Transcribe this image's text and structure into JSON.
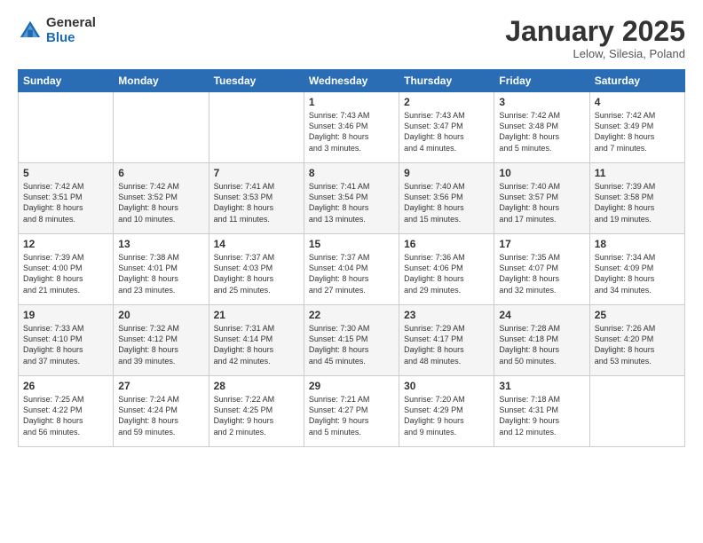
{
  "logo": {
    "general": "General",
    "blue": "Blue"
  },
  "header": {
    "title": "January 2025",
    "subtitle": "Lelow, Silesia, Poland"
  },
  "weekdays": [
    "Sunday",
    "Monday",
    "Tuesday",
    "Wednesday",
    "Thursday",
    "Friday",
    "Saturday"
  ],
  "weeks": [
    [
      {
        "day": "",
        "info": ""
      },
      {
        "day": "",
        "info": ""
      },
      {
        "day": "",
        "info": ""
      },
      {
        "day": "1",
        "info": "Sunrise: 7:43 AM\nSunset: 3:46 PM\nDaylight: 8 hours\nand 3 minutes."
      },
      {
        "day": "2",
        "info": "Sunrise: 7:43 AM\nSunset: 3:47 PM\nDaylight: 8 hours\nand 4 minutes."
      },
      {
        "day": "3",
        "info": "Sunrise: 7:42 AM\nSunset: 3:48 PM\nDaylight: 8 hours\nand 5 minutes."
      },
      {
        "day": "4",
        "info": "Sunrise: 7:42 AM\nSunset: 3:49 PM\nDaylight: 8 hours\nand 7 minutes."
      }
    ],
    [
      {
        "day": "5",
        "info": "Sunrise: 7:42 AM\nSunset: 3:51 PM\nDaylight: 8 hours\nand 8 minutes."
      },
      {
        "day": "6",
        "info": "Sunrise: 7:42 AM\nSunset: 3:52 PM\nDaylight: 8 hours\nand 10 minutes."
      },
      {
        "day": "7",
        "info": "Sunrise: 7:41 AM\nSunset: 3:53 PM\nDaylight: 8 hours\nand 11 minutes."
      },
      {
        "day": "8",
        "info": "Sunrise: 7:41 AM\nSunset: 3:54 PM\nDaylight: 8 hours\nand 13 minutes."
      },
      {
        "day": "9",
        "info": "Sunrise: 7:40 AM\nSunset: 3:56 PM\nDaylight: 8 hours\nand 15 minutes."
      },
      {
        "day": "10",
        "info": "Sunrise: 7:40 AM\nSunset: 3:57 PM\nDaylight: 8 hours\nand 17 minutes."
      },
      {
        "day": "11",
        "info": "Sunrise: 7:39 AM\nSunset: 3:58 PM\nDaylight: 8 hours\nand 19 minutes."
      }
    ],
    [
      {
        "day": "12",
        "info": "Sunrise: 7:39 AM\nSunset: 4:00 PM\nDaylight: 8 hours\nand 21 minutes."
      },
      {
        "day": "13",
        "info": "Sunrise: 7:38 AM\nSunset: 4:01 PM\nDaylight: 8 hours\nand 23 minutes."
      },
      {
        "day": "14",
        "info": "Sunrise: 7:37 AM\nSunset: 4:03 PM\nDaylight: 8 hours\nand 25 minutes."
      },
      {
        "day": "15",
        "info": "Sunrise: 7:37 AM\nSunset: 4:04 PM\nDaylight: 8 hours\nand 27 minutes."
      },
      {
        "day": "16",
        "info": "Sunrise: 7:36 AM\nSunset: 4:06 PM\nDaylight: 8 hours\nand 29 minutes."
      },
      {
        "day": "17",
        "info": "Sunrise: 7:35 AM\nSunset: 4:07 PM\nDaylight: 8 hours\nand 32 minutes."
      },
      {
        "day": "18",
        "info": "Sunrise: 7:34 AM\nSunset: 4:09 PM\nDaylight: 8 hours\nand 34 minutes."
      }
    ],
    [
      {
        "day": "19",
        "info": "Sunrise: 7:33 AM\nSunset: 4:10 PM\nDaylight: 8 hours\nand 37 minutes."
      },
      {
        "day": "20",
        "info": "Sunrise: 7:32 AM\nSunset: 4:12 PM\nDaylight: 8 hours\nand 39 minutes."
      },
      {
        "day": "21",
        "info": "Sunrise: 7:31 AM\nSunset: 4:14 PM\nDaylight: 8 hours\nand 42 minutes."
      },
      {
        "day": "22",
        "info": "Sunrise: 7:30 AM\nSunset: 4:15 PM\nDaylight: 8 hours\nand 45 minutes."
      },
      {
        "day": "23",
        "info": "Sunrise: 7:29 AM\nSunset: 4:17 PM\nDaylight: 8 hours\nand 48 minutes."
      },
      {
        "day": "24",
        "info": "Sunrise: 7:28 AM\nSunset: 4:18 PM\nDaylight: 8 hours\nand 50 minutes."
      },
      {
        "day": "25",
        "info": "Sunrise: 7:26 AM\nSunset: 4:20 PM\nDaylight: 8 hours\nand 53 minutes."
      }
    ],
    [
      {
        "day": "26",
        "info": "Sunrise: 7:25 AM\nSunset: 4:22 PM\nDaylight: 8 hours\nand 56 minutes."
      },
      {
        "day": "27",
        "info": "Sunrise: 7:24 AM\nSunset: 4:24 PM\nDaylight: 8 hours\nand 59 minutes."
      },
      {
        "day": "28",
        "info": "Sunrise: 7:22 AM\nSunset: 4:25 PM\nDaylight: 9 hours\nand 2 minutes."
      },
      {
        "day": "29",
        "info": "Sunrise: 7:21 AM\nSunset: 4:27 PM\nDaylight: 9 hours\nand 5 minutes."
      },
      {
        "day": "30",
        "info": "Sunrise: 7:20 AM\nSunset: 4:29 PM\nDaylight: 9 hours\nand 9 minutes."
      },
      {
        "day": "31",
        "info": "Sunrise: 7:18 AM\nSunset: 4:31 PM\nDaylight: 9 hours\nand 12 minutes."
      },
      {
        "day": "",
        "info": ""
      }
    ]
  ]
}
